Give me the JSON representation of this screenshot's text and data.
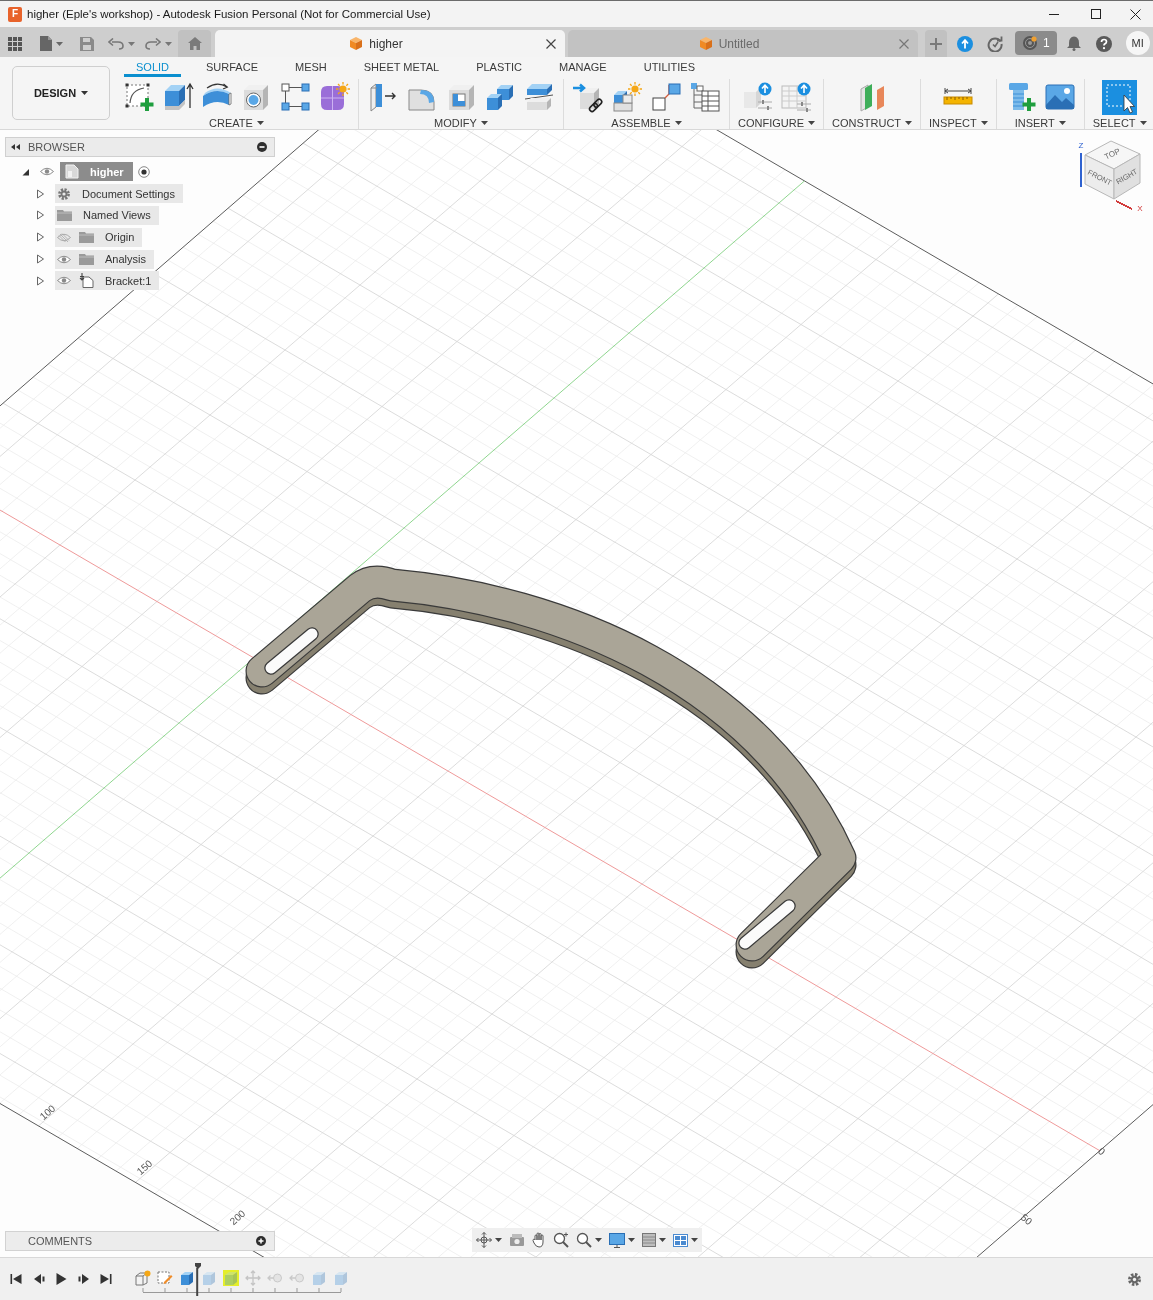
{
  "window": {
    "logo": "F",
    "title": "higher (Eple's workshop) - Autodesk Fusion Personal (Not for Commercial Use)"
  },
  "document_tabs": [
    {
      "label": "higher",
      "selected": true
    },
    {
      "label": "Untitled",
      "selected": false
    }
  ],
  "jobs": {
    "count": "1"
  },
  "account": {
    "initials": "MI"
  },
  "workspace": {
    "label": "DESIGN"
  },
  "toolbar_tabs": [
    {
      "label": "SOLID",
      "selected": true
    },
    {
      "label": "SURFACE",
      "selected": false
    },
    {
      "label": "MESH",
      "selected": false
    },
    {
      "label": "SHEET METAL",
      "selected": false
    },
    {
      "label": "PLASTIC",
      "selected": false
    },
    {
      "label": "MANAGE",
      "selected": false
    },
    {
      "label": "UTILITIES",
      "selected": false
    }
  ],
  "tool_groups": [
    {
      "label": "CREATE"
    },
    {
      "label": "MODIFY"
    },
    {
      "label": "ASSEMBLE"
    },
    {
      "label": "CONFIGURE"
    },
    {
      "label": "CONSTRUCT"
    },
    {
      "label": "INSPECT"
    },
    {
      "label": "INSERT"
    },
    {
      "label": "SELECT"
    }
  ],
  "browser": {
    "title": "BROWSER",
    "root": {
      "label": "higher",
      "kind": "component",
      "expanded": true,
      "visible": true,
      "active": true,
      "children": [
        {
          "label": "Document Settings",
          "kind": "settings",
          "expanded": false
        },
        {
          "label": "Named Views",
          "kind": "folder",
          "expanded": false
        },
        {
          "label": "Origin",
          "kind": "folder",
          "expanded": false,
          "visible": false
        },
        {
          "label": "Analysis",
          "kind": "folder",
          "expanded": false,
          "visible": true
        },
        {
          "label": "Bracket:1",
          "kind": "component-pin",
          "expanded": false,
          "visible": true
        }
      ]
    }
  },
  "viewcube": {
    "faces": [
      "TOP",
      "FRONT",
      "RIGHT"
    ],
    "axes": [
      {
        "label": "Z",
        "color": "#2f62d0"
      },
      {
        "label": "X",
        "color": "#d23c3c"
      }
    ]
  },
  "grid_labels": [
    "100",
    "150",
    "200",
    "50",
    "0"
  ],
  "comments": {
    "title": "COMMENTS"
  },
  "timeline": {
    "features": [
      {
        "kind": "component",
        "rolled_back": false,
        "selected": false
      },
      {
        "kind": "sketch",
        "rolled_back": false,
        "selected": false
      },
      {
        "kind": "extrude",
        "rolled_back": false,
        "selected": false
      },
      {
        "kind": "extrude",
        "rolled_back": true,
        "selected": false
      },
      {
        "kind": "extrude",
        "rolled_back": true,
        "selected": true
      },
      {
        "kind": "move",
        "rolled_back": true,
        "selected": false
      },
      {
        "kind": "joint",
        "rolled_back": true,
        "selected": false
      },
      {
        "kind": "joint",
        "rolled_back": true,
        "selected": false
      },
      {
        "kind": "extrude",
        "rolled_back": true,
        "selected": false
      },
      {
        "kind": "extrude",
        "rolled_back": true,
        "selected": false
      }
    ]
  }
}
